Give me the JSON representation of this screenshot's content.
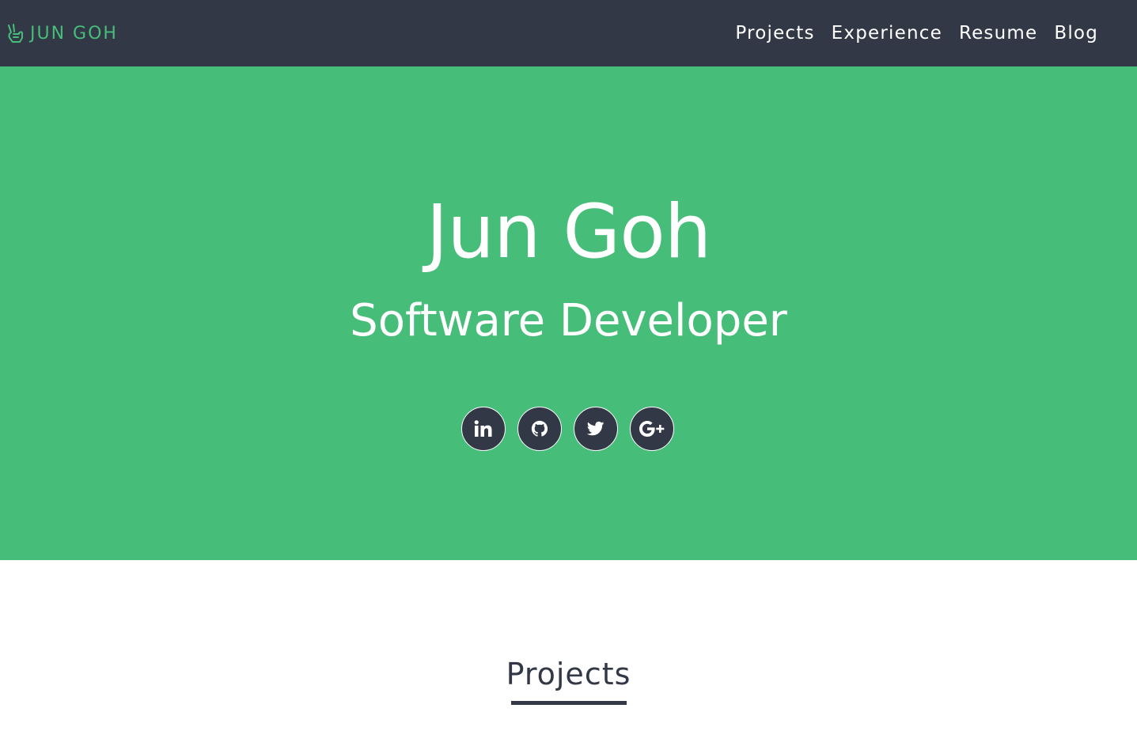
{
  "navbar": {
    "brand_text": "JUN GOH",
    "brand_icon": "peace-hand-icon",
    "links": [
      "Projects",
      "Experience",
      "Resume",
      "Blog"
    ]
  },
  "hero": {
    "name": "Jun Goh",
    "title": "Software Developer",
    "social": [
      {
        "icon": "linkedin-icon"
      },
      {
        "icon": "github-icon"
      },
      {
        "icon": "twitter-icon"
      },
      {
        "icon": "google-plus-icon"
      }
    ]
  },
  "sections": {
    "projects_heading": "Projects"
  },
  "colors": {
    "navbar_bg": "#323846",
    "accent_green": "#47bd7a",
    "text_white": "#ffffff",
    "heading_dark": "#323846"
  }
}
